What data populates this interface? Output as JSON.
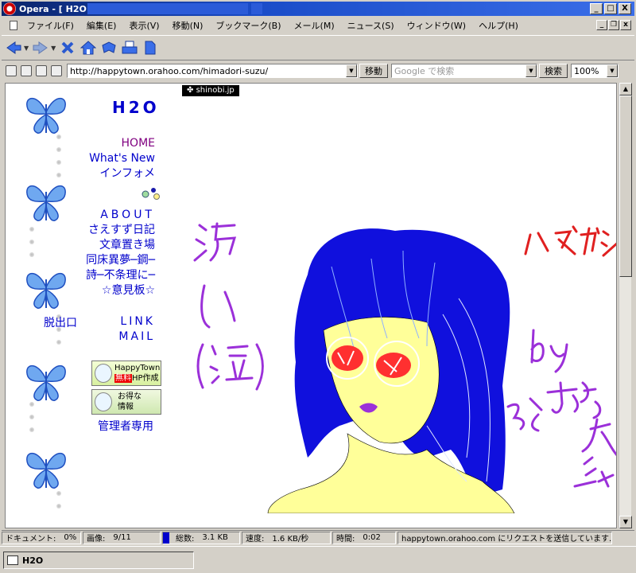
{
  "window": {
    "title": "Opera - [ H2O ]",
    "minimize_glyph": "_",
    "maximize_glyph": "□",
    "close_glyph": "X"
  },
  "menu": {
    "items": [
      "ファイル(F)",
      "編集(E)",
      "表示(V)",
      "移動(N)",
      "ブックマーク(B)",
      "メール(M)",
      "ニュース(S)",
      "ウィンドウ(W)",
      "ヘルプ(H)"
    ],
    "mdi_min": "_",
    "mdi_restore": "❐",
    "mdi_close": "x"
  },
  "toolbar": {
    "icons": [
      "back-icon",
      "forward-icon",
      "stop-icon",
      "home-icon",
      "hotlist-icon",
      "print-icon",
      "document-icon"
    ]
  },
  "address": {
    "url": "http://happytown.orahoo.com/himadori-suzu/",
    "go_label": "移動",
    "search_placeholder": "Google で検索",
    "search_label": "検索",
    "zoom": "100%"
  },
  "page": {
    "banner_tag": "shinobi.jp",
    "site_title": "H2O",
    "nav_primary": [
      "HOME",
      "What's New",
      "インフォメ"
    ],
    "nav_secondary": [
      "ABOUT",
      "さえすず日記",
      "文章置き場",
      "同床異夢─鋼─",
      "詩─不条理に─",
      "☆意見板☆"
    ],
    "exit_label": "脱出口",
    "nav_links": [
      "LINK",
      "MAIL"
    ],
    "ad1_top": "HappyTown",
    "ad1_free": "無料",
    "ad1_bottom": "HP作成",
    "ad2_top": "お得な",
    "ad2_bottom": "情報",
    "admin_label": "管理者専用"
  },
  "status": {
    "document_label": "ドキュメント:",
    "document_value": "0%",
    "images_label": "画像:",
    "images_value": "9/11",
    "total_label": "総数:",
    "total_value": "3.1 KB",
    "speed_label": "速度:",
    "speed_value": "1.6 KB/秒",
    "time_label": "時間:",
    "time_value": "0:02",
    "message": "happytown.orahoo.com にリクエストを送信しています..."
  },
  "taskbar": {
    "task_label": "H2O"
  },
  "colors": {
    "title_bar": "#0a246a",
    "link": "#0000cc",
    "visited": "#800080",
    "hair": "#1010dd",
    "skin": "#ffff99",
    "signature": "#9b30d9",
    "caption_red": "#e02020"
  }
}
